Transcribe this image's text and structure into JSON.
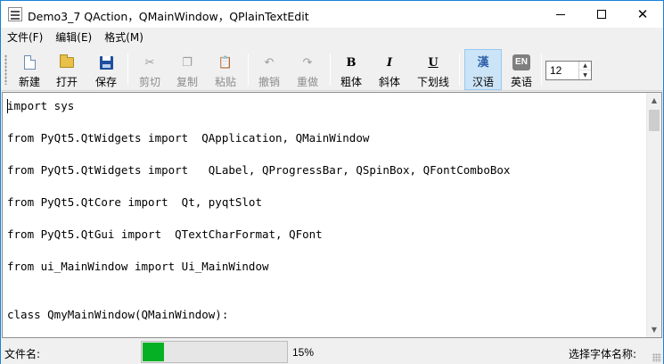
{
  "window": {
    "title": "Demo3_7 QAction，QMainWindow，QPlainTextEdit"
  },
  "menu": [
    "文件(F)",
    "编辑(E)",
    "格式(M)"
  ],
  "toolbar": {
    "new": "新建",
    "open": "打开",
    "save": "保存",
    "cut": "剪切",
    "copy": "复制",
    "paste": "粘贴",
    "undo": "撤销",
    "redo": "重做",
    "bold": "粗体",
    "italic": "斜体",
    "underline": "下划线",
    "chinese": "汉语",
    "english": "英语",
    "bold_glyph": "B",
    "italic_glyph": "I",
    "underline_glyph": "U",
    "chinese_glyph": "漢",
    "english_glyph": "EN",
    "font_size": "12"
  },
  "editor": {
    "lines": [
      "import sys",
      "from PyQt5.QtWidgets import  QApplication, QMainWindow",
      "from PyQt5.QtWidgets import   QLabel, QProgressBar, QSpinBox, QFontComboBox",
      "from PyQt5.QtCore import  Qt, pyqtSlot",
      "from PyQt5.QtGui import  QTextCharFormat, QFont",
      "from ui_MainWindow import Ui_MainWindow",
      "class QmyMainWindow(QMainWindow):"
    ]
  },
  "status": {
    "file_label": "文件名:",
    "progress_value": 15,
    "progress_text": "15%",
    "font_label": "选择字体名称:"
  },
  "colors": {
    "progress_fill": "#06b025",
    "window_border": "#1883d7",
    "checked_bg": "#cce4f7"
  }
}
